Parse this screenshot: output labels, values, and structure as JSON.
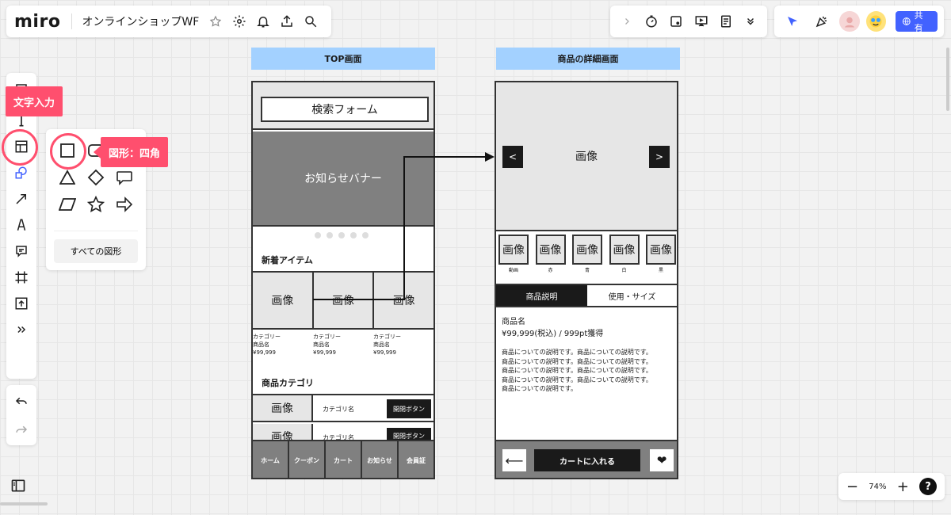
{
  "header": {
    "logo": "miro",
    "board_title": "オンラインショップWF",
    "share_label": "共有"
  },
  "toolbar": {
    "tools": [
      "sticky-note-icon",
      "text-icon",
      "template-icon",
      "shapes-icon",
      "arrow-icon",
      "pen-icon",
      "comment-icon",
      "frame-icon",
      "upload-icon",
      "more-icon"
    ]
  },
  "annotations": {
    "text_tooltip": "文字入力",
    "shape_tooltip": "図形：四角"
  },
  "shapes_panel": {
    "all_shapes": "すべての図形"
  },
  "top_wf": {
    "label": "TOP画面",
    "search": "検索フォーム",
    "banner": "お知らせバナー",
    "new_items": "新着アイテム",
    "image": "画像",
    "items": [
      {
        "category": "カテゴリー",
        "name": "商品名",
        "price": "¥99,999"
      },
      {
        "category": "カテゴリー",
        "name": "商品名",
        "price": "¥99,999"
      },
      {
        "category": "カテゴリー",
        "name": "商品名",
        "price": "¥99,999"
      }
    ],
    "categories_title": "商品カテゴリ",
    "category_name": "カテゴリ名",
    "toggle_button": "開閉ボタン",
    "nav": [
      "ホーム",
      "クーポン",
      "カート",
      "お知らせ",
      "会員証"
    ]
  },
  "detail_wf": {
    "label": "商品の詳細画面",
    "image": "画像",
    "prev": "<",
    "next": ">",
    "thumbs": [
      {
        "img": "画像",
        "label": "動画"
      },
      {
        "img": "画像",
        "label": "赤"
      },
      {
        "img": "画像",
        "label": "青"
      },
      {
        "img": "画像",
        "label": "白"
      },
      {
        "img": "画像",
        "label": "黒"
      }
    ],
    "tab_desc": "商品説明",
    "tab_usage": "使用・サイズ",
    "product_name": "商品名",
    "price": "¥99,999(税込) / 999pt獲得",
    "desc_lines": [
      "商品についての説明です。商品についての説明です。",
      "商品についての説明です。商品についての説明です。",
      "商品についての説明です。商品についての説明です。",
      "商品についての説明です。商品についての説明です。",
      "商品についての説明です。"
    ],
    "back": "⟵",
    "cart": "カートに入れる",
    "fav": "❤"
  },
  "zoom": {
    "minus": "−",
    "level": "74%",
    "plus": "+",
    "help": "?"
  }
}
